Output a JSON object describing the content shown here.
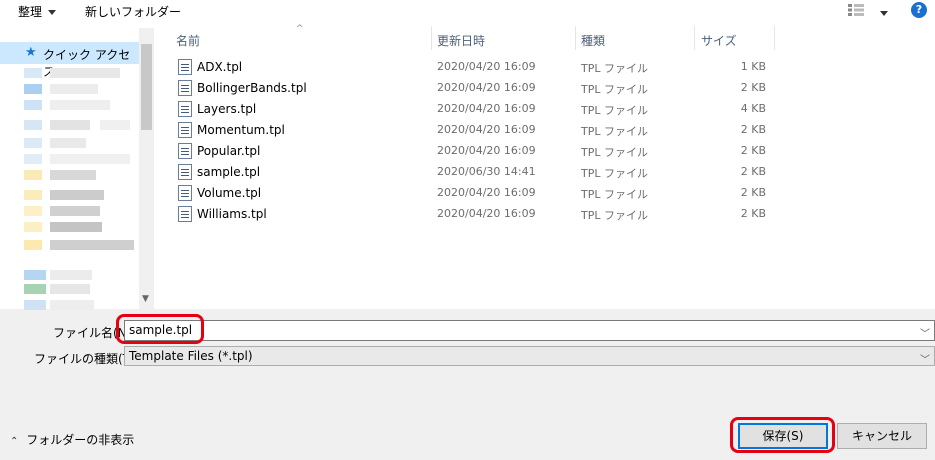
{
  "toolbar": {
    "organize_label": "整理",
    "new_folder_label": "新しいフォルダー",
    "help_label": "?"
  },
  "nav": {
    "quick_access_label": "クイック アクセス"
  },
  "columns": {
    "name": "名前",
    "modified": "更新日時",
    "type": "種類",
    "size": "サイズ"
  },
  "files": [
    {
      "name": "ADX.tpl",
      "modified": "2020/04/20 16:09",
      "type": "TPL ファイル",
      "size": "1 KB"
    },
    {
      "name": "BollingerBands.tpl",
      "modified": "2020/04/20 16:09",
      "type": "TPL ファイル",
      "size": "2 KB"
    },
    {
      "name": "Layers.tpl",
      "modified": "2020/04/20 16:09",
      "type": "TPL ファイル",
      "size": "4 KB"
    },
    {
      "name": "Momentum.tpl",
      "modified": "2020/04/20 16:09",
      "type": "TPL ファイル",
      "size": "2 KB"
    },
    {
      "name": "Popular.tpl",
      "modified": "2020/04/20 16:09",
      "type": "TPL ファイル",
      "size": "2 KB"
    },
    {
      "name": "sample.tpl",
      "modified": "2020/06/30 14:41",
      "type": "TPL ファイル",
      "size": "2 KB"
    },
    {
      "name": "Volume.tpl",
      "modified": "2020/04/20 16:09",
      "type": "TPL ファイル",
      "size": "2 KB"
    },
    {
      "name": "Williams.tpl",
      "modified": "2020/04/20 16:09",
      "type": "TPL ファイル",
      "size": "2 KB"
    }
  ],
  "form": {
    "filename_label": "ファイル名(N):",
    "filename_value": "sample.tpl",
    "filetype_label": "ファイルの種類(T):",
    "filetype_value": "Template Files (*.tpl)"
  },
  "footer": {
    "hide_folders_label": "フォルダーの非表示",
    "save_label": "保存(S)",
    "cancel_label": "キャンセル"
  },
  "colors": {
    "highlight": "#e60012",
    "accent": "#0078d7",
    "selection": "#cce8ff"
  }
}
